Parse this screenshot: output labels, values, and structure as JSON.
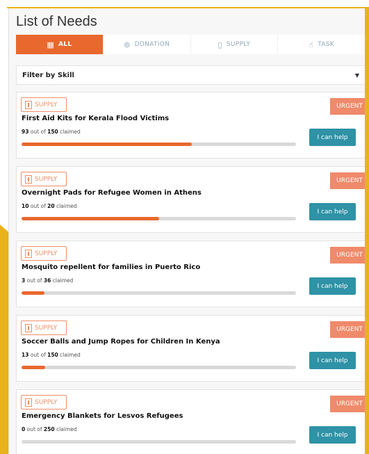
{
  "page": {
    "title": "List of Needs"
  },
  "tabs": [
    {
      "label": "ALL",
      "icon": "grid-icon",
      "active": true
    },
    {
      "label": "DONATION",
      "icon": "coins-icon",
      "active": false
    },
    {
      "label": "SUPPLY",
      "icon": "box-icon",
      "active": false
    },
    {
      "label": "TASK",
      "icon": "hand-icon",
      "active": false
    }
  ],
  "filter": {
    "label": "Filter by Skill"
  },
  "needs": [
    {
      "category": "SUPPLY",
      "title": "First Aid Kits for Kerala Flood Victims",
      "claimed": 93,
      "total": 150,
      "urgent_label": "URGENT",
      "action_label": "I can help"
    },
    {
      "category": "SUPPLY",
      "title": "Overnight Pads for Refugee Women in Athens",
      "claimed": 10,
      "total": 20,
      "urgent_label": "URGENT",
      "action_label": "I can help"
    },
    {
      "category": "SUPPLY",
      "title": "Mosquito repellent for families in Puerto Rico",
      "claimed": 3,
      "total": 36,
      "urgent_label": "URGENT",
      "action_label": "I can help"
    },
    {
      "category": "SUPPLY",
      "title": "Soccer Balls and Jump Ropes for Children In Kenya",
      "claimed": 13,
      "total": 150,
      "urgent_label": "URGENT",
      "action_label": "I can help"
    },
    {
      "category": "SUPPLY",
      "title": "Emergency Blankets for Lesvos Refugees",
      "claimed": 0,
      "total": 250,
      "urgent_label": "URGENT",
      "action_label": "I can help"
    }
  ],
  "claimed_text": {
    "out_of": "out of",
    "suffix": "claimed"
  },
  "colors": {
    "accent": "#e8682d",
    "urgent": "#ef8a6a",
    "button": "#2f92a6",
    "frame": "#e9b21a"
  }
}
